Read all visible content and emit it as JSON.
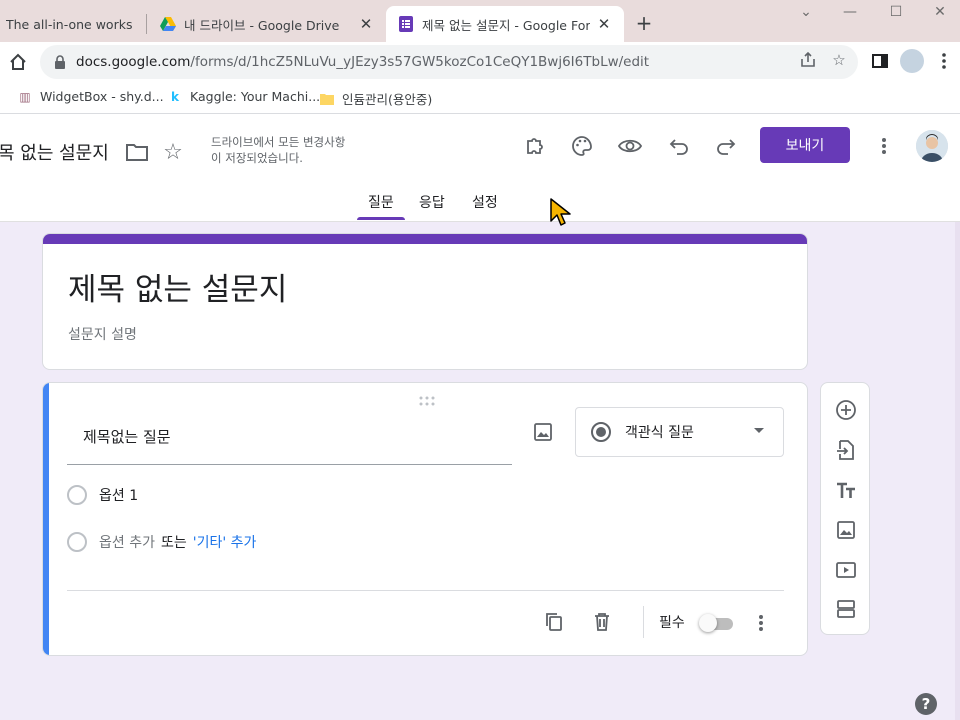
{
  "browser": {
    "tabs": [
      {
        "title": "The all-in-one worksp",
        "icon": "notion-icon"
      },
      {
        "title": "내 드라이브 - Google Drive",
        "icon": "google-drive-icon"
      },
      {
        "title": "제목 없는 설문지 - Google Form",
        "icon": "google-forms-icon",
        "active": true
      }
    ],
    "url_host": "docs.google.com",
    "url_path": "/forms/d/1hcZ5NLuVu_yJEzy3s57GW5kozCo1CeQY1Bwj6I6TbLw/edit",
    "bookmarks": [
      {
        "label": "WidgetBox - shy.d...",
        "icon": "widgetbox-icon"
      },
      {
        "label": "Kaggle: Your Machi...",
        "icon": "kaggle-icon"
      },
      {
        "label": "인듐관리(용안중)",
        "icon": "folder-icon"
      }
    ]
  },
  "header": {
    "doc_title": "목 없는 설문지",
    "save_status_line1": "드라이브에서 모든 변경사항",
    "save_status_line2": "이 저장되었습니다.",
    "send_label": "보내기",
    "tabs": [
      {
        "label": "질문",
        "active": true
      },
      {
        "label": "응답"
      },
      {
        "label": "설정"
      }
    ]
  },
  "form": {
    "title": "제목 없는 설문지",
    "description_placeholder": "설문지 설명",
    "question": {
      "title": "제목없는 질문",
      "type": "객관식 질문",
      "options": [
        "옵션 1"
      ],
      "add_option": "옵션 추가",
      "or_text": "또는",
      "add_other": "'기타' 추가",
      "required_label": "필수",
      "required": false
    }
  },
  "colors": {
    "accent": "#673ab7",
    "background": "#f0ebf8",
    "active_question_bar": "#4285f4",
    "link": "#1a73e8"
  }
}
